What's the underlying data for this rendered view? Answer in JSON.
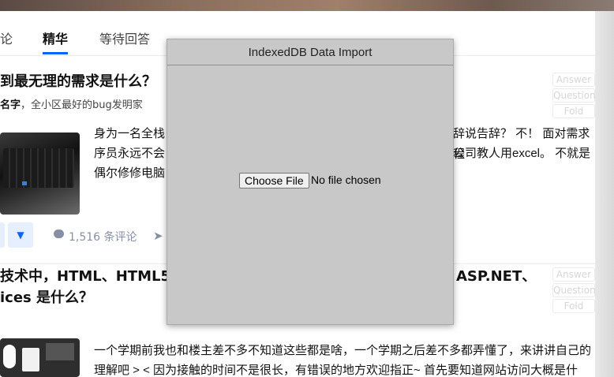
{
  "tabs": [
    {
      "label": "论"
    },
    {
      "label": "精华"
    },
    {
      "label": "等待回答"
    }
  ],
  "question1": {
    "title": "到最无理的需求是什么？",
    "author_name": "名字",
    "author_bio": "，全小区最好的bug发明家",
    "excerpt_line1_left": "身为一名全栈",
    "excerpt_line1_right": "辞说告辞？ 不！ 面对需求程",
    "excerpt_line2_left": "序员永远不会",
    "excerpt_line2_right": "公司教人用excel。 不就是",
    "excerpt_line3_left": "偶尔修修电脑",
    "comment_count": "1,516 条评论"
  },
  "question2": {
    "title_line1_left": "技术中，HTML、HTML5、",
    "title_line1_right": "ASP.NET、",
    "title_line2": "ices 是什么？",
    "excerpt_line1": "一个学期前我也和楼主差不多不知道这些都是啥，一个学期之后差不多都弄懂了，来讲讲自己的",
    "excerpt_line2": "理解吧 > < 因为接触的时间不是很长，有错误的地方欢迎指正~ 首先要知道网站访问大概是什"
  },
  "side_buttons": {
    "answer": "Answer",
    "question": "Question",
    "fold": "Fold"
  },
  "modal": {
    "title": "IndexedDB Data Import",
    "file_button": "Choose File",
    "file_status": "No file chosen"
  },
  "colors": {
    "accent": "#0066ff",
    "modal_bg": "#c8c8c8",
    "muted": "#8590a6"
  }
}
